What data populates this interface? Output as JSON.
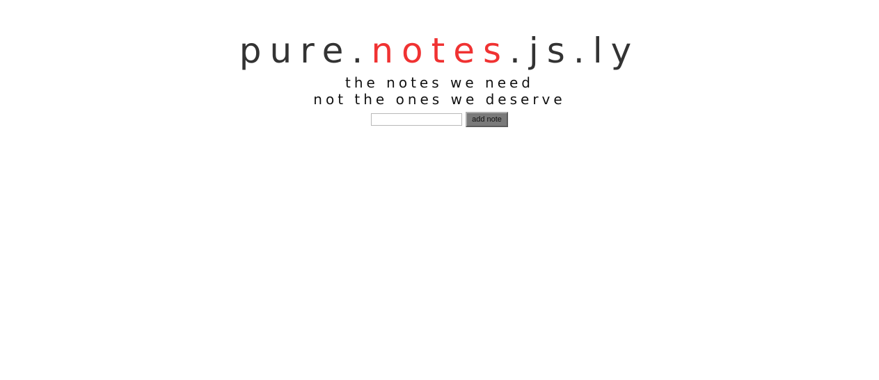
{
  "logo": {
    "part1": "pure.",
    "part2": "notes",
    "part3": ".js.ly",
    "accent_color": "#f03232",
    "text_color": "#333333"
  },
  "tagline": {
    "line1": "the notes we need",
    "line2": "not the ones we deserve"
  },
  "form": {
    "input_value": "",
    "button_label": "add note"
  }
}
